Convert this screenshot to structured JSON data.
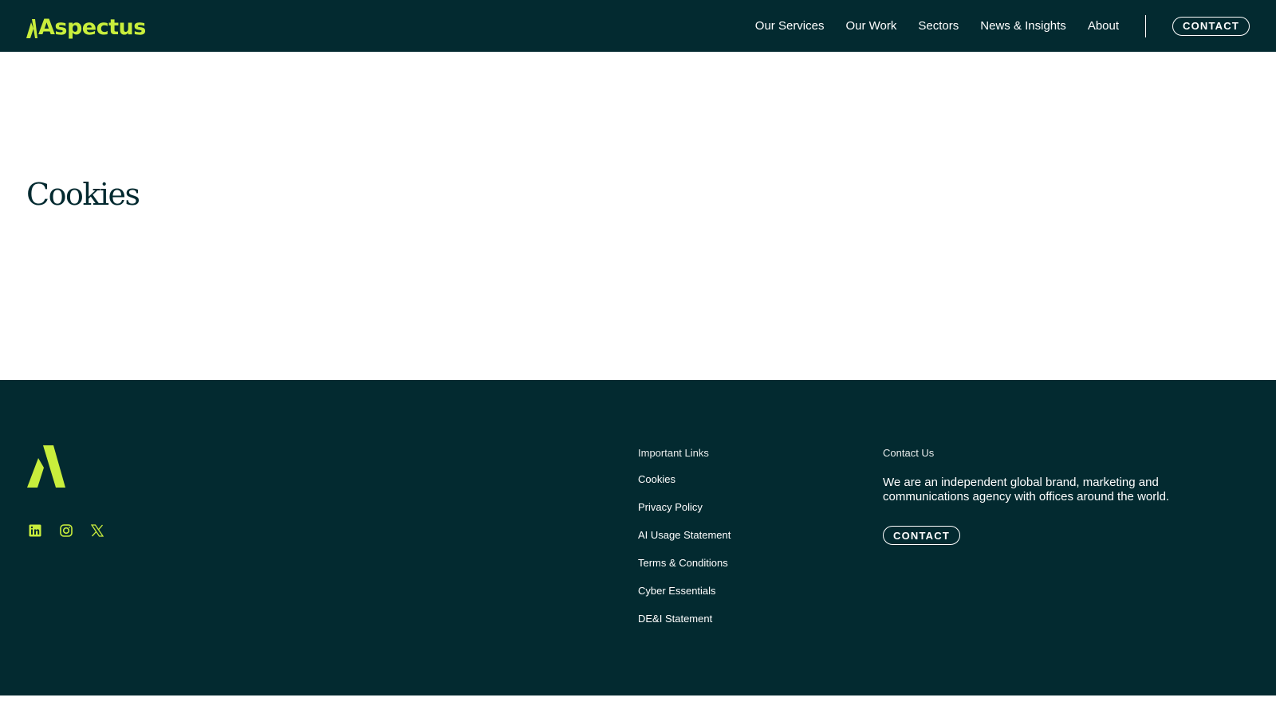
{
  "brand": {
    "name": "Aspectus",
    "accent_color": "#c9ee3c",
    "background_dark": "#032a30"
  },
  "header": {
    "nav": [
      {
        "label": "Our Services"
      },
      {
        "label": "Our Work"
      },
      {
        "label": "Sectors"
      },
      {
        "label": "News & Insights"
      },
      {
        "label": "About"
      }
    ],
    "contact_label": "CONTACT"
  },
  "main": {
    "title": "Cookies"
  },
  "footer": {
    "logo_icon": "aspectus-a-mark",
    "socials": [
      {
        "icon": "linkedin-icon"
      },
      {
        "icon": "instagram-icon"
      },
      {
        "icon": "x-twitter-icon"
      }
    ],
    "links_heading": "Important Links",
    "links": [
      {
        "label": "Cookies"
      },
      {
        "label": "Privacy Policy"
      },
      {
        "label": "AI Usage Statement"
      },
      {
        "label": "Terms & Conditions"
      },
      {
        "label": "Cyber Essentials"
      },
      {
        "label": "DE&I Statement"
      }
    ],
    "contact_heading": "Contact Us",
    "contact_text": "We are an independent global brand, marketing and communications agency with offices around the world.",
    "contact_label": "CONTACT"
  }
}
